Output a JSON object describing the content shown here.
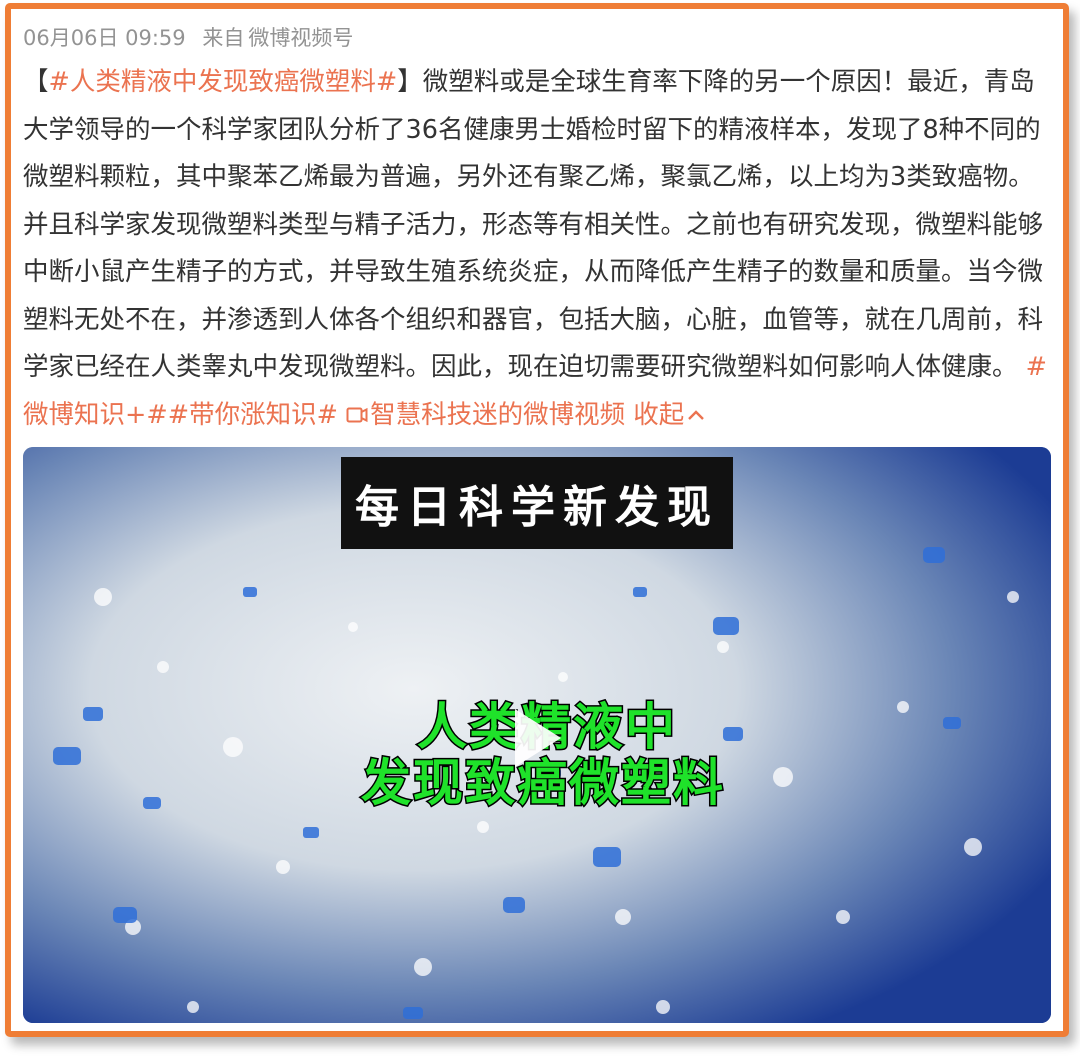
{
  "post": {
    "date": "06月06日 09:59",
    "source_prefix": "来自",
    "source": "微博视频号",
    "bracket_open": "【",
    "headline_tag": "#人类精液中发现致癌微塑料#",
    "bracket_close": "】",
    "body": "微塑料或是全球生育率下降的另一个原因！最近，青岛大学领导的一个科学家团队分析了36名健康男士婚检时留下的精液样本，发现了8种不同的微塑料颗粒，其中聚苯乙烯最为普遍，另外还有聚乙烯，聚氯乙烯，以上均为3类致癌物。并且科学家发现微塑料类型与精子活力，形态等有相关性。之前也有研究发现，微塑料能够中断小鼠产生精子的方式，并导致生殖系统炎症，从而降低产生精子的数量和质量。当今微塑料无处不在，并渗透到人体各个组织和器官，包括大脑，心脏，血管等，就在几周前，科学家已经在人类睾丸中发现微塑料。因此，现在迫切需要研究微塑料如何影响人体健康。",
    "tag1": "#微博知识+#",
    "tag2": "#带你涨知识#",
    "video_link_icon": "video-link-icon",
    "video_link": "智慧科技迷的微博视频",
    "collapse": "收起",
    "collapse_icon": "chevron-up-icon"
  },
  "video": {
    "title": "每日科学新发现",
    "overlay_line1": "人类精液中",
    "overlay_line2": "发现致癌微塑料",
    "play_icon": "play-icon"
  },
  "colors": {
    "border": "#ef7d35",
    "link": "#eb7350",
    "text": "#333333",
    "meta": "#939393",
    "overlay_green": "#1fe22a"
  }
}
